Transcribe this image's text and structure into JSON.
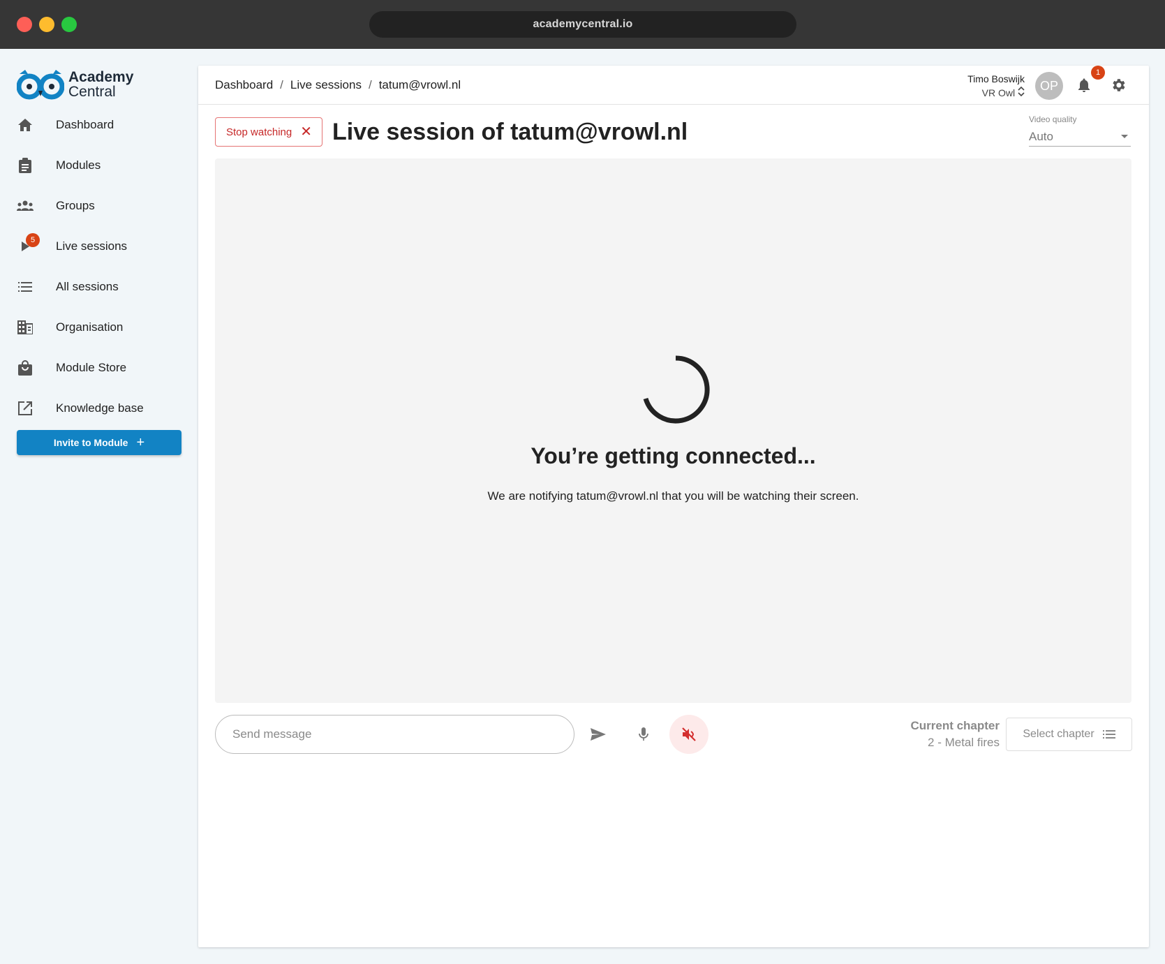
{
  "browser": {
    "url": "academycentral.io"
  },
  "logo": {
    "line1": "Academy",
    "line2": "Central"
  },
  "sidebar": {
    "items": [
      {
        "label": "Dashboard",
        "icon": "home-icon"
      },
      {
        "label": "Modules",
        "icon": "clipboard-icon"
      },
      {
        "label": "Groups",
        "icon": "groups-icon"
      },
      {
        "label": "Live sessions",
        "icon": "play-icon",
        "badge": "5"
      },
      {
        "label": "All sessions",
        "icon": "list-icon"
      },
      {
        "label": "Organisation",
        "icon": "building-icon"
      },
      {
        "label": "Module Store",
        "icon": "shopping-bag-icon"
      },
      {
        "label": "Knowledge base",
        "icon": "open-in-new-icon"
      }
    ],
    "invite_label": "Invite to Module",
    "invite_icon": "+"
  },
  "header": {
    "breadcrumb": [
      "Dashboard",
      "Live sessions",
      "tatum@vrowl.nl"
    ],
    "breadcrumb_sep": "/",
    "user_name": "Timo Boswijk",
    "org_name": "VR Owl",
    "avatar_initials": "OP",
    "notification_count": "1"
  },
  "session": {
    "stop_label": "Stop watching",
    "stop_icon": "✕",
    "title": "Live session of tatum@vrowl.nl",
    "video_quality_label": "Video quality",
    "video_quality_value": "Auto",
    "connecting_title": "You’re getting connected...",
    "connecting_message": "We are notifying tatum@vrowl.nl that you will be watching their screen."
  },
  "controls": {
    "message_placeholder": "Send message",
    "current_chapter_label": "Current chapter",
    "current_chapter_value": "2 - Metal fires",
    "select_chapter_label": "Select chapter"
  },
  "colors": {
    "primary": "#1283c4",
    "badge": "#d84315",
    "danger": "#c62828",
    "logo": "#1283c4"
  }
}
